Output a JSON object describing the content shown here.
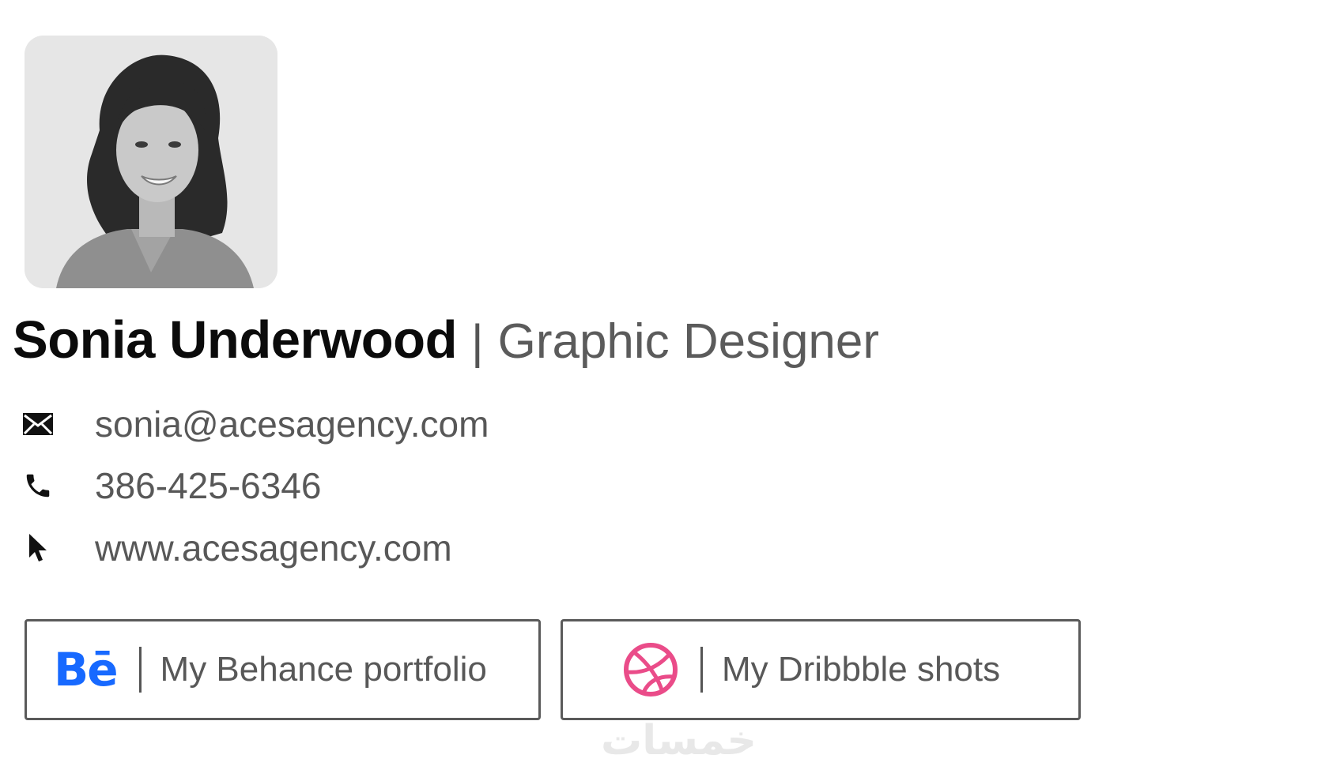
{
  "signature": {
    "name": "Sonia Underwood",
    "separator": "|",
    "title": "Graphic Designer",
    "avatar_icon": "profile-photo"
  },
  "contacts": {
    "email": {
      "icon": "envelope-icon",
      "text": "sonia@acesagency.com"
    },
    "phone": {
      "icon": "phone-icon",
      "text": "386-425-6346"
    },
    "website": {
      "icon": "cursor-icon",
      "text": "www.acesagency.com"
    }
  },
  "buttons": {
    "behance": {
      "logo": "Bē",
      "label": "My Behance portfolio",
      "color": "#1769ff"
    },
    "dribbble": {
      "icon": "dribbble-icon",
      "label": "My Dribbble shots",
      "color": "#ea4c89"
    }
  },
  "watermark": {
    "text": "خمسات"
  }
}
